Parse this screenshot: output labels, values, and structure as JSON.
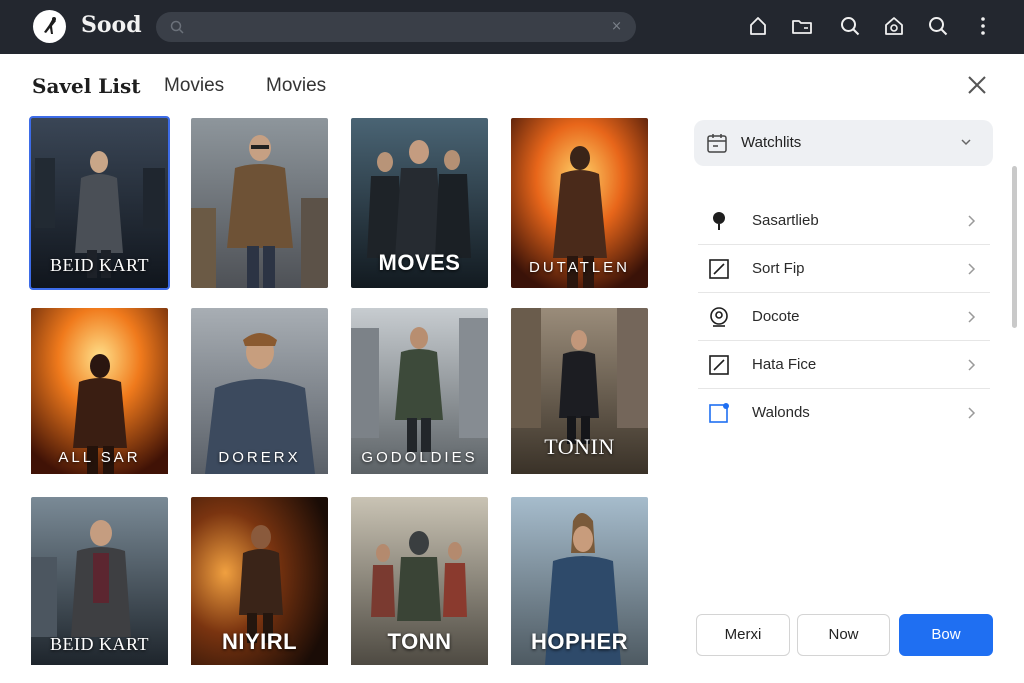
{
  "topbar": {
    "app_name": "Sood",
    "search_placeholder": "",
    "search_clear": "×",
    "icons": [
      "home-icon",
      "folder-icon",
      "search-icon",
      "shield-home-icon",
      "search-icon",
      "more-icon"
    ]
  },
  "header": {
    "title": "Savel List",
    "tabs": [
      {
        "label": "Movies"
      },
      {
        "label": "Movies"
      }
    ]
  },
  "posters": [
    {
      "title": "BEID KART"
    },
    {
      "title": ""
    },
    {
      "title": "MOVES"
    },
    {
      "title": "DUTATLEN"
    },
    {
      "title": "ALL SAR"
    },
    {
      "title": "DORERX"
    },
    {
      "title": "GODOLDIES"
    },
    {
      "title": "TONIN"
    },
    {
      "title": "BEID KART"
    },
    {
      "title": "NIYIRL"
    },
    {
      "title": "TONN"
    },
    {
      "title": "HOPHER"
    }
  ],
  "sidebar": {
    "dropdown_label": "Watchlits",
    "items": [
      {
        "label": "Sasartlieb",
        "icon": "pin-icon"
      },
      {
        "label": "Sort Fip",
        "icon": "edit-square-icon"
      },
      {
        "label": "Docote",
        "icon": "badge-icon"
      },
      {
        "label": "Hata Fice",
        "icon": "edit-square-icon"
      },
      {
        "label": "Walonds",
        "icon": "notification-square-icon"
      }
    ]
  },
  "footer": {
    "buttons": [
      {
        "label": "Merxi"
      },
      {
        "label": "Now"
      },
      {
        "label": "Bow"
      }
    ]
  },
  "colors": {
    "topbar": "#23272f",
    "accent": "#1f6ff2",
    "selection": "#3d6ce8"
  }
}
